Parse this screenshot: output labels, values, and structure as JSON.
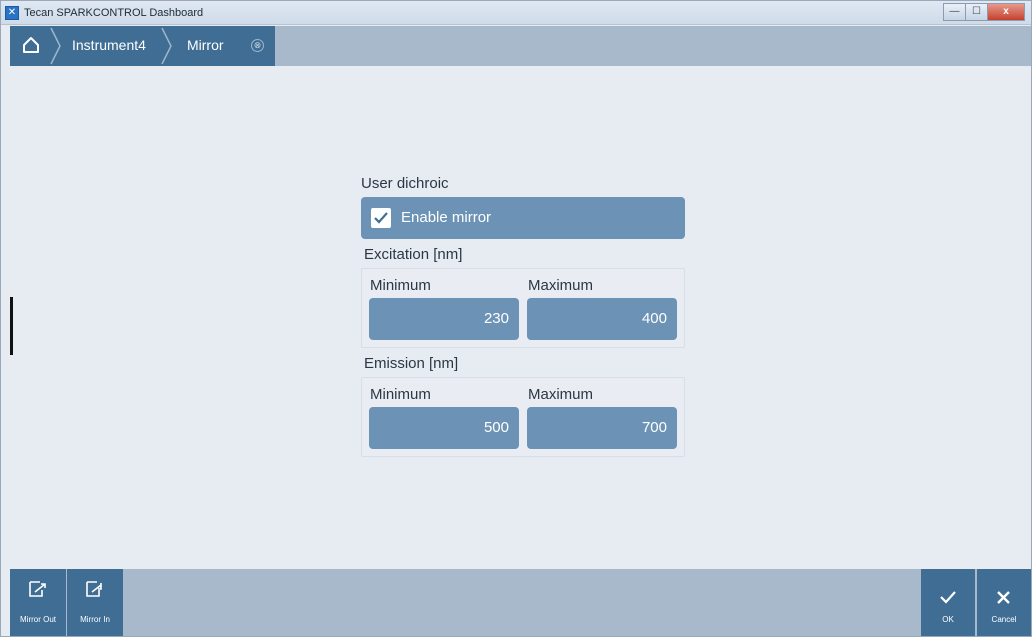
{
  "window": {
    "title": "Tecan SPARKCONTROL Dashboard",
    "controls": {
      "minimize": "—",
      "maximize": "☐",
      "close": "x"
    }
  },
  "breadcrumb": {
    "items": [
      "Instrument4",
      "Mirror"
    ],
    "close_glyph": "⊗"
  },
  "form": {
    "section_title": "User dichroic",
    "enable_mirror": {
      "label": "Enable mirror",
      "checked": true
    },
    "excitation": {
      "title": "Excitation [nm]",
      "min_label": "Minimum",
      "max_label": "Maximum",
      "min_value": "230",
      "max_value": "400"
    },
    "emission": {
      "title": "Emission [nm]",
      "min_label": "Minimum",
      "max_label": "Maximum",
      "min_value": "500",
      "max_value": "700"
    }
  },
  "toolbar": {
    "mirror_out": "Mirror Out",
    "mirror_in": "Mirror In",
    "ok": "OK",
    "cancel": "Cancel"
  },
  "colors": {
    "accent": "#3f6d94",
    "field": "#6c93b6",
    "bar": "#a8b9cc",
    "background": "#e7ebf2"
  }
}
